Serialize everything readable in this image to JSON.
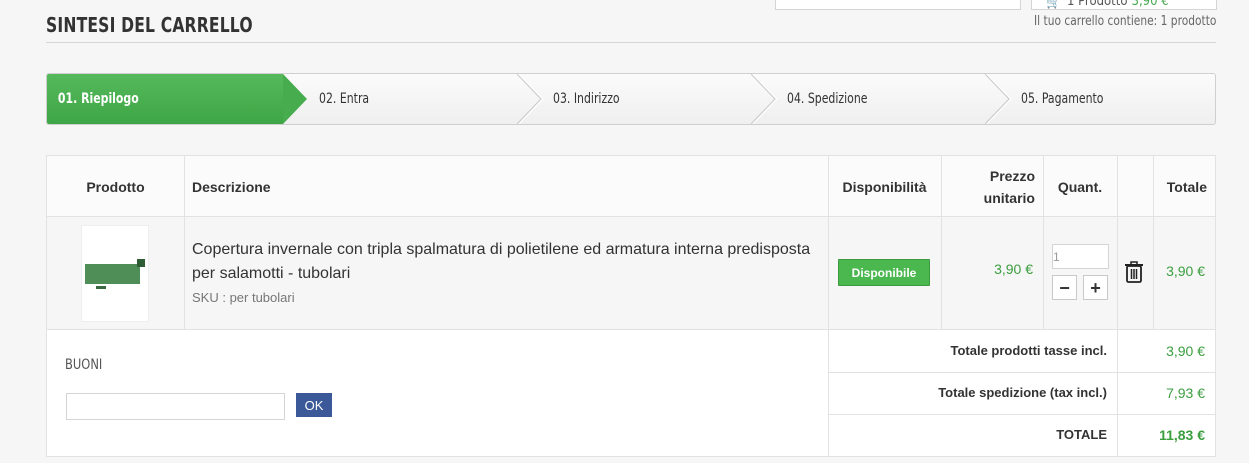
{
  "header": {
    "cart_summary_count": "1 Prodotto",
    "cart_summary_amount": "3,90 €",
    "page_title": "SINTESI DEL CARRELLO",
    "cart_info": "Il tuo carrello contiene: 1 prodotto"
  },
  "steps": [
    {
      "label": "01. Riepilogo",
      "active": true
    },
    {
      "label": "02. Entra",
      "active": false
    },
    {
      "label": "03. Indirizzo",
      "active": false
    },
    {
      "label": "04. Spedizione",
      "active": false
    },
    {
      "label": "05. Pagamento",
      "active": false
    }
  ],
  "table": {
    "headers": {
      "product": "Prodotto",
      "description": "Descrizione",
      "availability": "Disponibilità",
      "unit_price_line1": "Prezzo",
      "unit_price_line2": "unitario",
      "quantity": "Quant.",
      "total": "Totale"
    },
    "item": {
      "description": "Copertura invernale con tripla spalmatura di polietilene ed armatura interna predisposta per salamotti - tubolari",
      "sku": "SKU : per tubolari",
      "availability": "Disponibile",
      "unit_price": "3,90 €",
      "quantity": "1",
      "total": "3,90 €"
    }
  },
  "vouchers": {
    "label": "BUONI",
    "input_value": "",
    "ok_label": "OK"
  },
  "summary": {
    "products_label": "Totale prodotti tasse incl.",
    "products_value": "3,90 €",
    "shipping_label": "Totale spedizione (tax incl.)",
    "shipping_value": "7,93 €",
    "total_label": "TOTALE",
    "total_value": "11,83 €"
  },
  "colors": {
    "accent_green": "#46ac4d",
    "price_green": "#3b9e3f",
    "ok_button": "#3b5998"
  }
}
